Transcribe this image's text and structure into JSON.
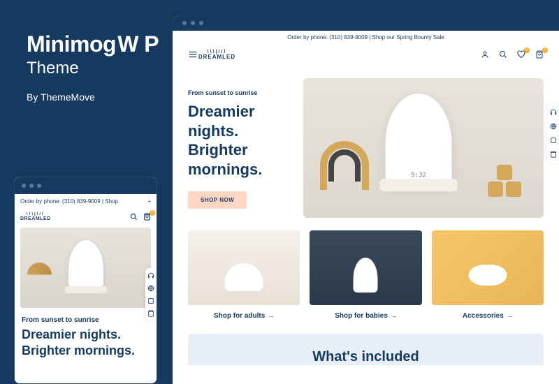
{
  "sidebar": {
    "title": "Minimog W P",
    "subtitle": "Theme",
    "byline": "By ThemeMove"
  },
  "topbar": "Order by phone: (310) 839-9009 | Shop our Spring Bounty Sale",
  "topbar_mobile": "Order by phone: (310) 839-9009 | Shop",
  "logo": "DREAMLED",
  "cart_count": "0",
  "wishlist_count": "0",
  "hero": {
    "eyebrow": "From sunset to sunrise",
    "headline": "Dreamier nights. Brighter mornings.",
    "cta": "SHOP NOW",
    "time": "9:32"
  },
  "cards": [
    {
      "label": "Shop for adults"
    },
    {
      "label": "Shop for babies"
    },
    {
      "label": "Accessories"
    }
  ],
  "section_title": "What's included"
}
